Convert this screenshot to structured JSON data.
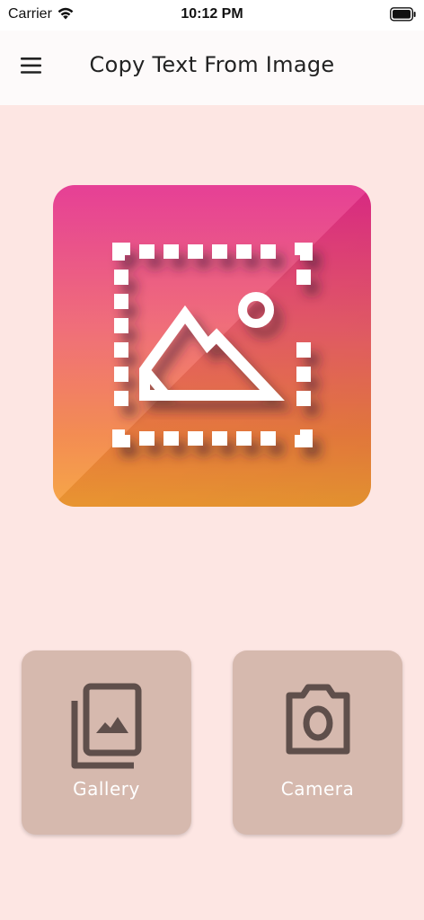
{
  "status_bar": {
    "carrier": "Carrier",
    "time": "10:12 PM",
    "wifi_icon": "wifi-icon",
    "battery_icon": "battery-icon"
  },
  "app_bar": {
    "title": "Copy Text From Image",
    "menu_icon": "hamburger-menu-icon"
  },
  "hero": {
    "icon": "image-selection-icon",
    "gradient_colors": [
      "#e32a8a",
      "#ee5f6a",
      "#f2803f",
      "#f59d33"
    ]
  },
  "actions": {
    "gallery": {
      "label": "Gallery",
      "icon": "gallery-icon"
    },
    "camera": {
      "label": "Camera",
      "icon": "camera-icon"
    }
  },
  "colors": {
    "background": "#fde6e3",
    "card": "#d6b9ae",
    "card_icon": "#5f4f4b"
  }
}
